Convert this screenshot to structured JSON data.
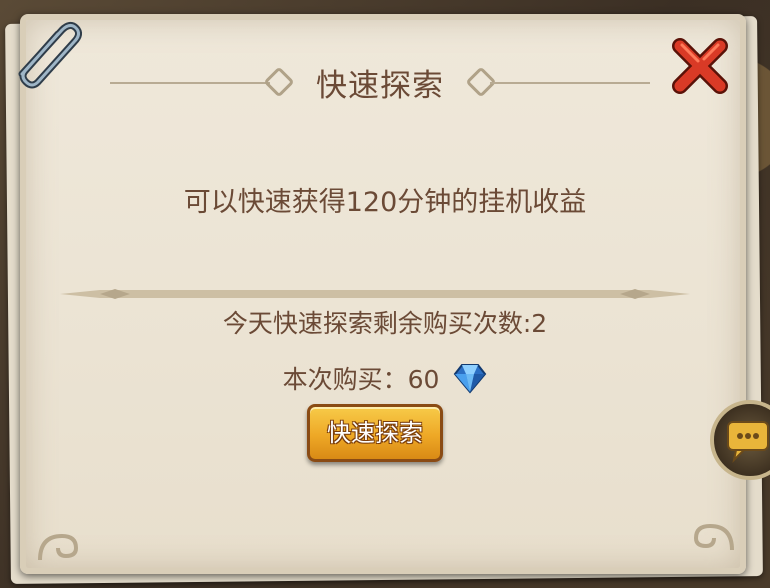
{
  "dialog": {
    "title": "快速探索",
    "description": "可以快速获得120分钟的挂机收益",
    "remaining_label": "今天快速探索剩余购买次数:2",
    "cost_label": "本次购买：60",
    "explore_button_label": "快速探索"
  },
  "icons": {
    "close": "close-icon",
    "diamond": "diamond-icon",
    "paperclip": "paperclip-icon",
    "chat": "chat-icon"
  },
  "colors": {
    "panel_bg": "#ebe3d3",
    "text_brown": "#6b4a36",
    "button_gold": "#eea826",
    "close_red": "#d02a20",
    "diamond_blue": "#3b8de0"
  }
}
